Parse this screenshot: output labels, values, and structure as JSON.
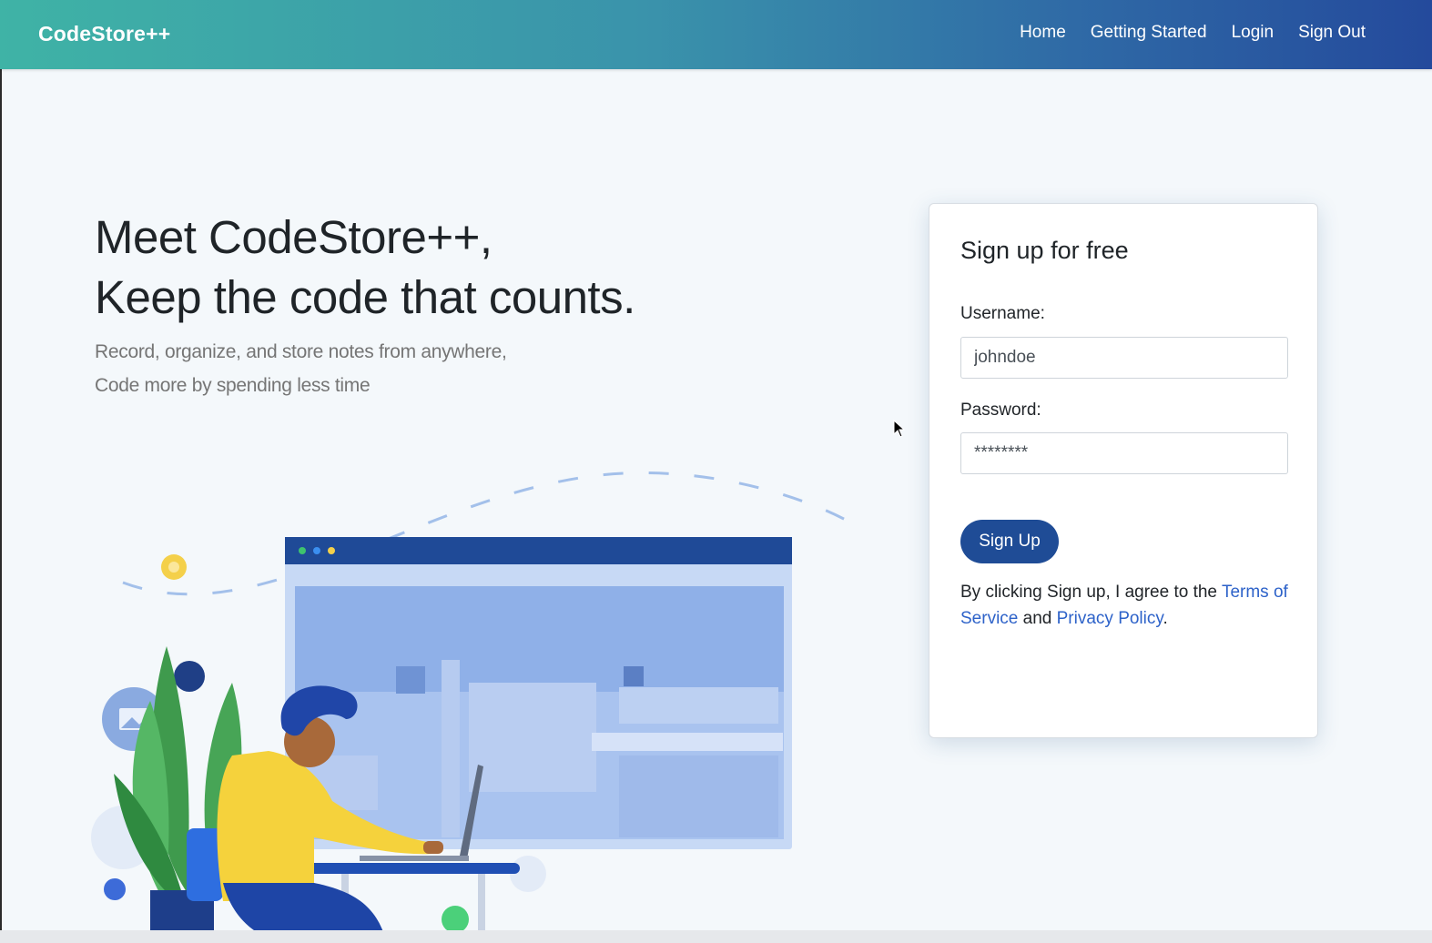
{
  "navbar": {
    "brand": "CodeStore++",
    "links": [
      {
        "label": "Home"
      },
      {
        "label": "Getting Started"
      },
      {
        "label": "Login"
      },
      {
        "label": "Sign Out"
      }
    ]
  },
  "hero": {
    "title_line1": "Meet CodeStore++,",
    "title_line2": "Keep the code that counts.",
    "subtitle_line1": "Record, organize, and store notes from anywhere,",
    "subtitle_line2": "Code more by spending less time"
  },
  "signup": {
    "title": "Sign up for free",
    "username_label": "Username:",
    "username_value": "johndoe",
    "password_label": "Password:",
    "password_value": "********",
    "button_label": "Sign Up",
    "terms_prefix": "By clicking Sign up, I agree to the ",
    "terms_link": "Terms of Service",
    "terms_middle": " and ",
    "privacy_link": "Privacy Policy",
    "terms_suffix": "."
  },
  "colors": {
    "nav_gradient_start": "#3fb3a6",
    "nav_gradient_end": "#244a9c",
    "primary_button": "#1f4c96",
    "link": "#2d62c9"
  },
  "icons": [
    "mouse-cursor-icon",
    "image-badge-icon"
  ]
}
